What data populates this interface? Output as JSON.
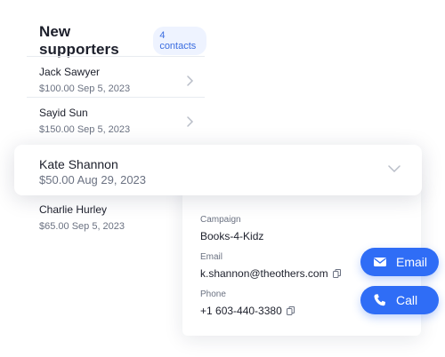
{
  "list": {
    "title": "New supporters",
    "count_badge": "4 contacts",
    "rows": [
      {
        "name": "Jack Sawyer",
        "meta": "$100.00 Sep 5, 2023"
      },
      {
        "name": "Sayid Sun",
        "meta": "$150.00 Sep 5, 2023"
      },
      {
        "name": "Charlie Hurley",
        "meta": "$65.00 Sep 5, 2023"
      }
    ]
  },
  "selected": {
    "name": "Kate Shannon",
    "meta": "$50.00 Aug 29, 2023"
  },
  "details": {
    "campaign_label": "Campaign",
    "campaign_value": "Books-4-Kidz",
    "email_label": "Email",
    "email_value": "k.shannon@theothers.com",
    "phone_label": "Phone",
    "phone_value": "+1 603-440-3380"
  },
  "actions": {
    "email_label": "Email",
    "call_label": "Call"
  },
  "icons": {
    "row_chevron": "chevron-right-icon",
    "focus_chevron": "chevron-down-icon",
    "copy": "copy-icon",
    "email": "envelope-icon",
    "call": "phone-icon"
  },
  "colors": {
    "accent": "#2f6df6",
    "badge_bg": "#eef3ff",
    "badge_text": "#3b6de0"
  }
}
